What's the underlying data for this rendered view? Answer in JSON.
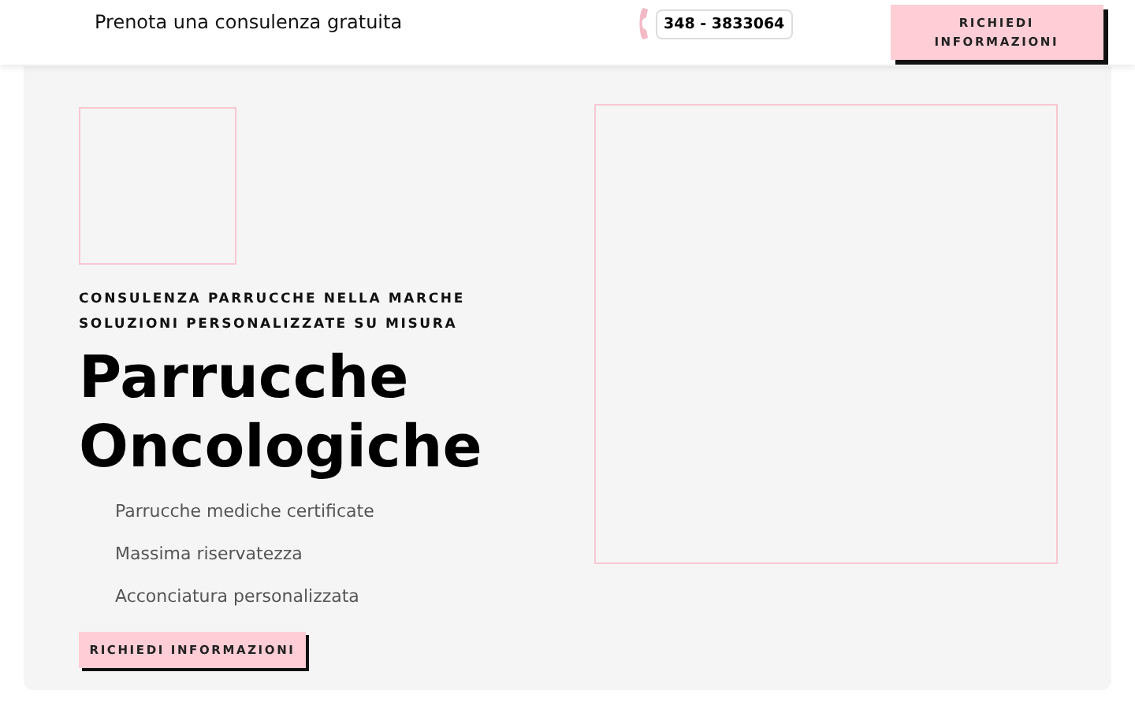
{
  "header": {
    "tagline": "Prenota una consulenza gratuita",
    "phone": "348 - 3833064",
    "button": "RICHIEDI INFORMAZIONI"
  },
  "hero": {
    "kicker_lines": [
      "CONSULENZA PARRUCCHE NELLA MARCHE",
      "SOLUZIONI PERSONALIZZATE SU MISURA"
    ],
    "title_lines": [
      "Parrucche",
      "Oncologiche"
    ],
    "features": [
      "Parrucche mediche certificate",
      "Massima riservatezza",
      "Acconciatura personalizzata"
    ],
    "button": "RICHIEDI INFORMAZIONI"
  }
}
